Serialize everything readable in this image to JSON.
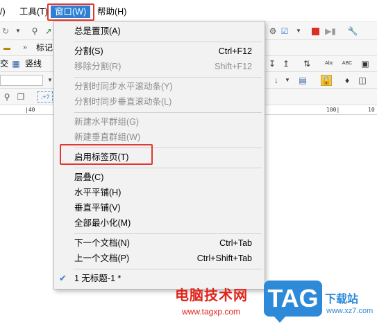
{
  "menubar": {
    "items": [
      {
        "label": "/)",
        "state": "normal"
      },
      {
        "label": "工具(T)",
        "state": "normal"
      },
      {
        "label": "窗口(W)",
        "state": "active"
      },
      {
        "label": "帮助(H)",
        "state": "normal"
      }
    ]
  },
  "toolbar": {
    "text_biaoji": "标记",
    "text_jiao": "交",
    "text_shuxian": "竖线",
    "ruler_ticks": [
      "|40",
      "100|",
      "10"
    ]
  },
  "window_menu": {
    "items": [
      {
        "label": "总是置顶(A)",
        "shortcut": "",
        "disabled": false
      },
      {
        "label": "分割(S)",
        "shortcut": "Ctrl+F12",
        "disabled": false
      },
      {
        "label": "移除分割(R)",
        "shortcut": "Shift+F12",
        "disabled": true
      },
      {
        "label": "分割时同步水平滚动条(Y)",
        "shortcut": "",
        "disabled": true
      },
      {
        "label": "分割时同步垂直滚动条(L)",
        "shortcut": "",
        "disabled": true
      },
      {
        "label": "新建水平群组(G)",
        "shortcut": "",
        "disabled": true
      },
      {
        "label": "新建垂直群组(W)",
        "shortcut": "",
        "disabled": true
      },
      {
        "label": "启用标签页(T)",
        "shortcut": "",
        "disabled": false,
        "highlighted": true
      },
      {
        "label": "层叠(C)",
        "shortcut": "",
        "disabled": false
      },
      {
        "label": "水平平铺(H)",
        "shortcut": "",
        "disabled": false
      },
      {
        "label": "垂直平铺(V)",
        "shortcut": "",
        "disabled": false
      },
      {
        "label": "全部最小化(M)",
        "shortcut": "",
        "disabled": false
      },
      {
        "label": "下一个文档(N)",
        "shortcut": "Ctrl+Tab",
        "disabled": false
      },
      {
        "label": "上一个文档(P)",
        "shortcut": "Ctrl+Shift+Tab",
        "disabled": false
      },
      {
        "label": "1 无标题-1 *",
        "shortcut": "",
        "disabled": false,
        "checked": true
      }
    ]
  },
  "watermark": {
    "cn_text": "电脑技术网",
    "url": "www.tagxp.com",
    "tag": "TAG",
    "site_cn": "下载站",
    "site_url": "www.xz7.com"
  },
  "colors": {
    "accent": "#2f7fd3",
    "highlight_box": "#e2382f",
    "watermark_red": "#e2231a",
    "watermark_blue": "#2c8ad8"
  }
}
